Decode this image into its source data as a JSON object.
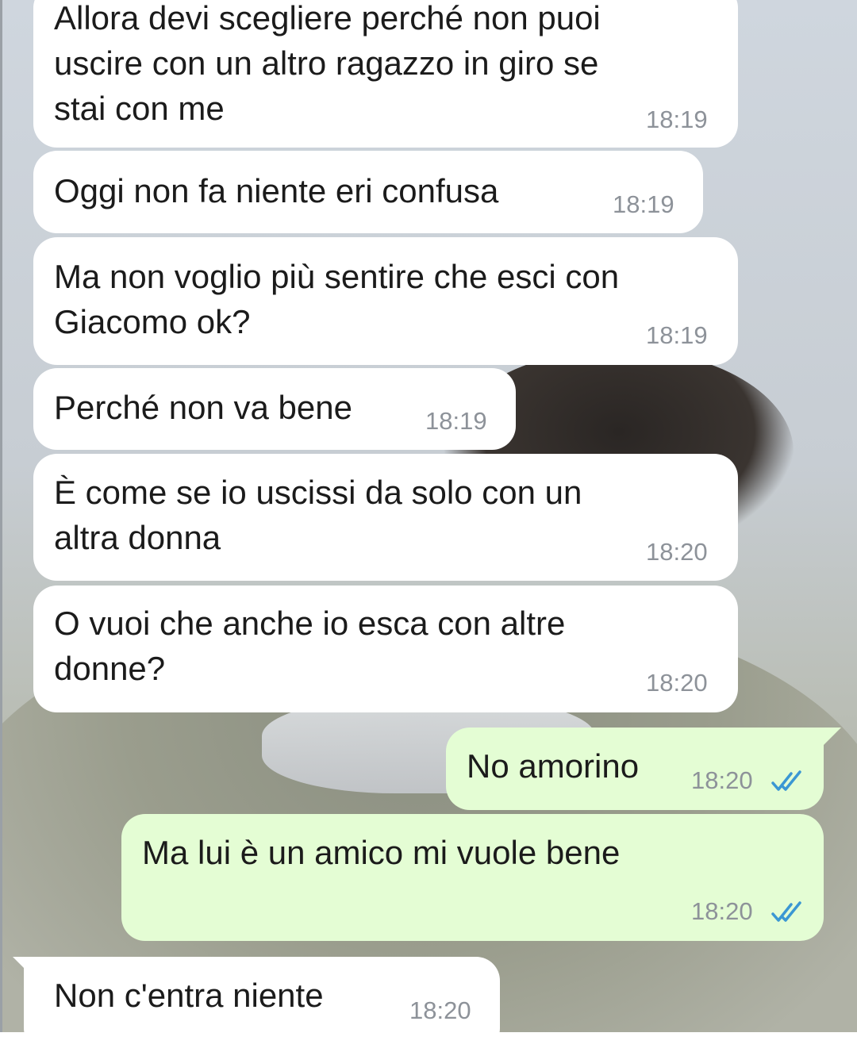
{
  "chat": {
    "messages": [
      {
        "direction": "in",
        "text": "Allora devi scegliere perché non puoi\nuscire con un altro ragazzo in giro se\nstai con me",
        "time": "18:19"
      },
      {
        "direction": "in",
        "text": "Oggi non fa niente eri confusa",
        "time": "18:19"
      },
      {
        "direction": "in",
        "text": "Ma non voglio più sentire che esci con\nGiacomo ok?",
        "time": "18:19"
      },
      {
        "direction": "in",
        "text": "Perché non va bene",
        "time": "18:19"
      },
      {
        "direction": "in",
        "text": "È come se io uscissi da solo con un\naltra donna",
        "time": "18:20"
      },
      {
        "direction": "in",
        "text": "O vuoi che anche io esca con altre\ndonne?",
        "time": "18:20"
      },
      {
        "direction": "out",
        "text": "No amorino",
        "time": "18:20",
        "status": "read"
      },
      {
        "direction": "out",
        "text": "Ma lui è un amico mi vuole bene",
        "time": "18:20",
        "status": "read"
      },
      {
        "direction": "in",
        "text": "Non c'entra niente",
        "time": "18:20"
      }
    ]
  },
  "colors": {
    "incoming_bubble": "#ffffff",
    "outgoing_bubble": "#e4fdd4",
    "timestamp": "#8d9299",
    "read_ticks": "#3b97d3"
  },
  "icons": {
    "read_status": "double-check-icon"
  }
}
